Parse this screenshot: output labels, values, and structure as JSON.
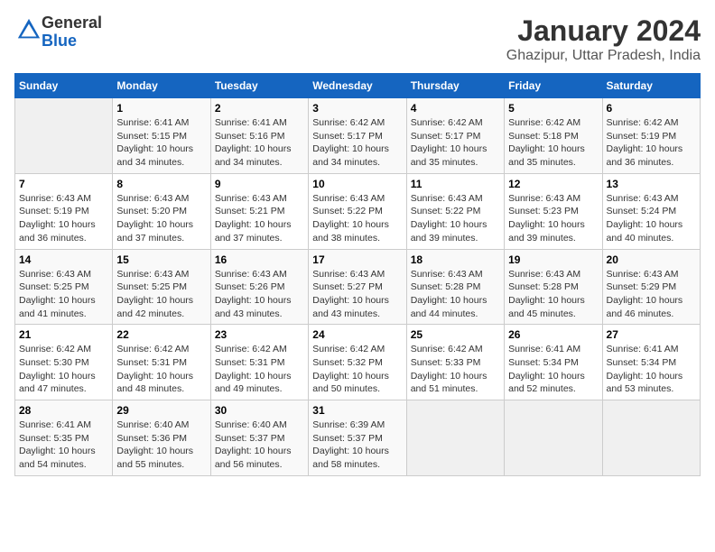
{
  "header": {
    "logo_line1": "General",
    "logo_line2": "Blue",
    "month_title": "January 2024",
    "location": "Ghazipur, Uttar Pradesh, India"
  },
  "days_of_week": [
    "Sunday",
    "Monday",
    "Tuesday",
    "Wednesday",
    "Thursday",
    "Friday",
    "Saturday"
  ],
  "weeks": [
    [
      {
        "day": "",
        "empty": true
      },
      {
        "day": "1",
        "sunrise": "6:41 AM",
        "sunset": "5:15 PM",
        "daylight": "10 hours and 34 minutes."
      },
      {
        "day": "2",
        "sunrise": "6:41 AM",
        "sunset": "5:16 PM",
        "daylight": "10 hours and 34 minutes."
      },
      {
        "day": "3",
        "sunrise": "6:42 AM",
        "sunset": "5:17 PM",
        "daylight": "10 hours and 34 minutes."
      },
      {
        "day": "4",
        "sunrise": "6:42 AM",
        "sunset": "5:17 PM",
        "daylight": "10 hours and 35 minutes."
      },
      {
        "day": "5",
        "sunrise": "6:42 AM",
        "sunset": "5:18 PM",
        "daylight": "10 hours and 35 minutes."
      },
      {
        "day": "6",
        "sunrise": "6:42 AM",
        "sunset": "5:19 PM",
        "daylight": "10 hours and 36 minutes."
      }
    ],
    [
      {
        "day": "7",
        "sunrise": "6:43 AM",
        "sunset": "5:19 PM",
        "daylight": "10 hours and 36 minutes."
      },
      {
        "day": "8",
        "sunrise": "6:43 AM",
        "sunset": "5:20 PM",
        "daylight": "10 hours and 37 minutes."
      },
      {
        "day": "9",
        "sunrise": "6:43 AM",
        "sunset": "5:21 PM",
        "daylight": "10 hours and 37 minutes."
      },
      {
        "day": "10",
        "sunrise": "6:43 AM",
        "sunset": "5:22 PM",
        "daylight": "10 hours and 38 minutes."
      },
      {
        "day": "11",
        "sunrise": "6:43 AM",
        "sunset": "5:22 PM",
        "daylight": "10 hours and 39 minutes."
      },
      {
        "day": "12",
        "sunrise": "6:43 AM",
        "sunset": "5:23 PM",
        "daylight": "10 hours and 39 minutes."
      },
      {
        "day": "13",
        "sunrise": "6:43 AM",
        "sunset": "5:24 PM",
        "daylight": "10 hours and 40 minutes."
      }
    ],
    [
      {
        "day": "14",
        "sunrise": "6:43 AM",
        "sunset": "5:25 PM",
        "daylight": "10 hours and 41 minutes."
      },
      {
        "day": "15",
        "sunrise": "6:43 AM",
        "sunset": "5:25 PM",
        "daylight": "10 hours and 42 minutes."
      },
      {
        "day": "16",
        "sunrise": "6:43 AM",
        "sunset": "5:26 PM",
        "daylight": "10 hours and 43 minutes."
      },
      {
        "day": "17",
        "sunrise": "6:43 AM",
        "sunset": "5:27 PM",
        "daylight": "10 hours and 43 minutes."
      },
      {
        "day": "18",
        "sunrise": "6:43 AM",
        "sunset": "5:28 PM",
        "daylight": "10 hours and 44 minutes."
      },
      {
        "day": "19",
        "sunrise": "6:43 AM",
        "sunset": "5:28 PM",
        "daylight": "10 hours and 45 minutes."
      },
      {
        "day": "20",
        "sunrise": "6:43 AM",
        "sunset": "5:29 PM",
        "daylight": "10 hours and 46 minutes."
      }
    ],
    [
      {
        "day": "21",
        "sunrise": "6:42 AM",
        "sunset": "5:30 PM",
        "daylight": "10 hours and 47 minutes."
      },
      {
        "day": "22",
        "sunrise": "6:42 AM",
        "sunset": "5:31 PM",
        "daylight": "10 hours and 48 minutes."
      },
      {
        "day": "23",
        "sunrise": "6:42 AM",
        "sunset": "5:31 PM",
        "daylight": "10 hours and 49 minutes."
      },
      {
        "day": "24",
        "sunrise": "6:42 AM",
        "sunset": "5:32 PM",
        "daylight": "10 hours and 50 minutes."
      },
      {
        "day": "25",
        "sunrise": "6:42 AM",
        "sunset": "5:33 PM",
        "daylight": "10 hours and 51 minutes."
      },
      {
        "day": "26",
        "sunrise": "6:41 AM",
        "sunset": "5:34 PM",
        "daylight": "10 hours and 52 minutes."
      },
      {
        "day": "27",
        "sunrise": "6:41 AM",
        "sunset": "5:34 PM",
        "daylight": "10 hours and 53 minutes."
      }
    ],
    [
      {
        "day": "28",
        "sunrise": "6:41 AM",
        "sunset": "5:35 PM",
        "daylight": "10 hours and 54 minutes."
      },
      {
        "day": "29",
        "sunrise": "6:40 AM",
        "sunset": "5:36 PM",
        "daylight": "10 hours and 55 minutes."
      },
      {
        "day": "30",
        "sunrise": "6:40 AM",
        "sunset": "5:37 PM",
        "daylight": "10 hours and 56 minutes."
      },
      {
        "day": "31",
        "sunrise": "6:39 AM",
        "sunset": "5:37 PM",
        "daylight": "10 hours and 58 minutes."
      },
      {
        "day": "",
        "empty": true
      },
      {
        "day": "",
        "empty": true
      },
      {
        "day": "",
        "empty": true
      }
    ]
  ]
}
